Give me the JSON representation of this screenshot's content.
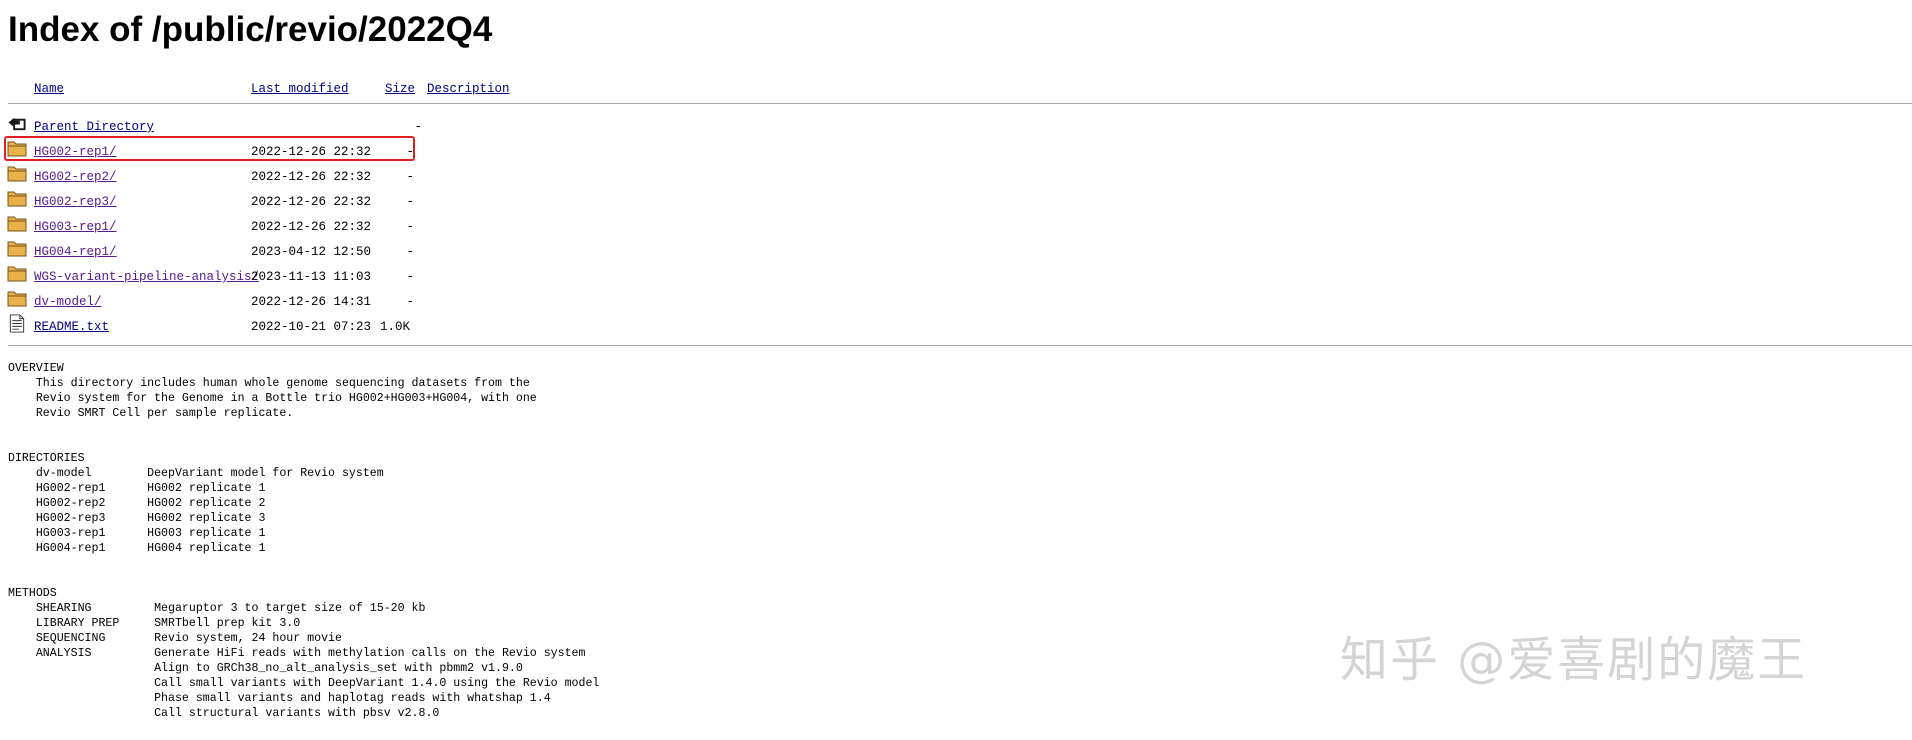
{
  "page": {
    "title": "Index of /public/revio/2022Q4"
  },
  "columns": {
    "name": "Name",
    "last_modified": "Last modified",
    "size": "Size",
    "description": "Description"
  },
  "rows": [
    {
      "icon": "back-icon",
      "name": "Parent Directory",
      "date": "",
      "size": "-"
    },
    {
      "icon": "folder-icon",
      "name": "HG002-rep1/",
      "date": "2022-12-26 22:32",
      "size": "-",
      "highlighted": true
    },
    {
      "icon": "folder-icon",
      "name": "HG002-rep2/",
      "date": "2022-12-26 22:32",
      "size": "-"
    },
    {
      "icon": "folder-icon",
      "name": "HG002-rep3/",
      "date": "2022-12-26 22:32",
      "size": "-"
    },
    {
      "icon": "folder-icon",
      "name": "HG003-rep1/",
      "date": "2022-12-26 22:32",
      "size": "-"
    },
    {
      "icon": "folder-icon",
      "name": "HG004-rep1/",
      "date": "2023-04-12 12:50",
      "size": "-"
    },
    {
      "icon": "folder-icon",
      "name": "WGS-variant-pipeline-analysis/",
      "date": "2023-11-13 11:03",
      "size": "-"
    },
    {
      "icon": "folder-icon",
      "name": "dv-model/",
      "date": "2022-12-26 14:31",
      "size": "-"
    },
    {
      "icon": "text-file-icon",
      "name": "README.txt",
      "date": "2022-10-21 07:23",
      "size": "1.0K"
    }
  ],
  "readme": {
    "text": "OVERVIEW\n    This directory includes human whole genome sequencing datasets from the\n    Revio system for the Genome in a Bottle trio HG002+HG003+HG004, with one\n    Revio SMRT Cell per sample replicate.\n\n\nDIRECTORIES\n    dv-model        DeepVariant model for Revio system\n    HG002-rep1      HG002 replicate 1\n    HG002-rep2      HG002 replicate 2\n    HG002-rep3      HG002 replicate 3\n    HG003-rep1      HG003 replicate 1\n    HG004-rep1      HG004 replicate 1\n\n\nMETHODS\n    SHEARING         Megaruptor 3 to target size of 15-20 kb\n    LIBRARY PREP     SMRTbell prep kit 3.0\n    SEQUENCING       Revio system, 24 hour movie\n    ANALYSIS         Generate HiFi reads with methylation calls on the Revio system\n                     Align to GRCh38_no_alt_analysis_set with pbmm2 v1.9.0\n                     Call small variants with DeepVariant 1.4.0 using the Revio model\n                     Phase small variants and haplotag reads with whatshap 1.4\n                     Call structural variants with pbsv v2.8.0"
  },
  "watermark": {
    "text": "知乎 @爱喜剧的魔王"
  },
  "colors": {
    "link": "#000080",
    "visited_link": "#551a8b",
    "highlight_border": "#e02020",
    "folder": "#e8b14a"
  }
}
